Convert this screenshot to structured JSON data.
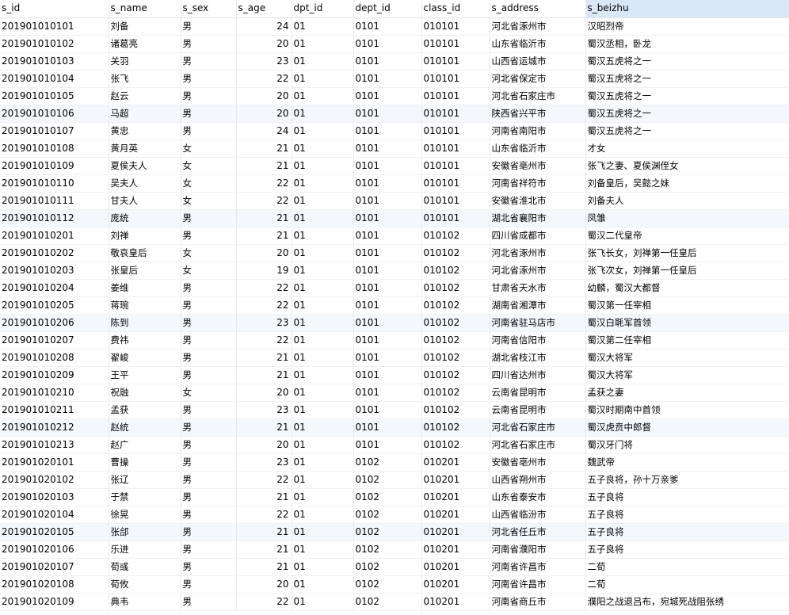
{
  "columns": [
    "s_id",
    "s_name",
    "s_sex",
    "s_age",
    "dpt_id",
    "dept_id",
    "class_id",
    "s_address",
    "s_beizhu"
  ],
  "selected_column": "s_beizhu",
  "rows": [
    [
      "201901010101",
      "刘备",
      "男",
      "24",
      "01",
      "0101",
      "010101",
      "河北省涿州市",
      "汉昭烈帝"
    ],
    [
      "201901010102",
      "诸葛亮",
      "男",
      "20",
      "01",
      "0101",
      "010101",
      "山东省临沂市",
      "蜀汉丞相，卧龙"
    ],
    [
      "201901010103",
      "关羽",
      "男",
      "23",
      "01",
      "0101",
      "010101",
      "山西省运城市",
      "蜀汉五虎将之一"
    ],
    [
      "201901010104",
      "张飞",
      "男",
      "22",
      "01",
      "0101",
      "010101",
      "河北省保定市",
      "蜀汉五虎将之一"
    ],
    [
      "201901010105",
      "赵云",
      "男",
      "20",
      "01",
      "0101",
      "010101",
      "河北省石家庄市",
      "蜀汉五虎将之一"
    ],
    [
      "201901010106",
      "马超",
      "男",
      "20",
      "01",
      "0101",
      "010101",
      "陕西省兴平市",
      "蜀汉五虎将之一"
    ],
    [
      "201901010107",
      "黄忠",
      "男",
      "24",
      "01",
      "0101",
      "010101",
      "河南省南阳市",
      "蜀汉五虎将之一"
    ],
    [
      "201901010108",
      "黄月英",
      "女",
      "21",
      "01",
      "0101",
      "010101",
      "山东省临沂市",
      "才女"
    ],
    [
      "201901010109",
      "夏侯夫人",
      "女",
      "21",
      "01",
      "0101",
      "010101",
      "安徽省亳州市",
      "张飞之妻、夏侯渊侄女"
    ],
    [
      "201901010110",
      "吴夫人",
      "女",
      "22",
      "01",
      "0101",
      "010101",
      "河南省祥符市",
      "刘备皇后，吴懿之妹"
    ],
    [
      "201901010111",
      "甘夫人",
      "女",
      "22",
      "01",
      "0101",
      "010101",
      "安徽省淮北市",
      "刘备夫人"
    ],
    [
      "201901010112",
      "庞统",
      "男",
      "21",
      "01",
      "0101",
      "010101",
      "湖北省襄阳市",
      "凤雏"
    ],
    [
      "201901010201",
      "刘禅",
      "男",
      "21",
      "01",
      "0101",
      "010102",
      "四川省成都市",
      "蜀汉二代皇帝"
    ],
    [
      "201901010202",
      "敬哀皇后",
      "女",
      "20",
      "01",
      "0101",
      "010102",
      "河北省涿州市",
      "张飞长女，刘禅第一任皇后"
    ],
    [
      "201901010203",
      "张皇后",
      "女",
      "19",
      "01",
      "0101",
      "010102",
      "河北省涿州市",
      "张飞次女，刘禅第一任皇后"
    ],
    [
      "201901010204",
      "姜维",
      "男",
      "22",
      "01",
      "0101",
      "010102",
      "甘肃省天水市",
      "幼麟，蜀汉大都督"
    ],
    [
      "201901010205",
      "蒋琬",
      "男",
      "22",
      "01",
      "0101",
      "010102",
      "湖南省湘潭市",
      "蜀汉第一任宰相"
    ],
    [
      "201901010206",
      "陈到",
      "男",
      "23",
      "01",
      "0101",
      "010102",
      "河南省驻马店市",
      "蜀汉白毦军首领"
    ],
    [
      "201901010207",
      "费祎",
      "男",
      "22",
      "01",
      "0101",
      "010102",
      "河南省信阳市",
      "蜀汉第二任宰相"
    ],
    [
      "201901010208",
      "翟峻",
      "男",
      "21",
      "01",
      "0101",
      "010102",
      "湖北省枝江市",
      "蜀汉大将军"
    ],
    [
      "201901010209",
      "王平",
      "男",
      "21",
      "01",
      "0101",
      "010102",
      "四川省达州市",
      "蜀汉大将军"
    ],
    [
      "201901010210",
      "祝融",
      "女",
      "20",
      "01",
      "0101",
      "010102",
      "云南省昆明市",
      "孟获之妻"
    ],
    [
      "201901010211",
      "孟获",
      "男",
      "23",
      "01",
      "0101",
      "010102",
      "云南省昆明市",
      "蜀汉时期南中首领"
    ],
    [
      "201901010212",
      "赵统",
      "男",
      "21",
      "01",
      "0101",
      "010102",
      "河北省石家庄市",
      "蜀汉虎贲中郎督"
    ],
    [
      "201901010213",
      "赵广",
      "男",
      "20",
      "01",
      "0101",
      "010102",
      "河北省石家庄市",
      "蜀汉牙门将"
    ],
    [
      "201901020101",
      "曹操",
      "男",
      "23",
      "01",
      "0102",
      "010201",
      "安徽省亳州市",
      "魏武帝"
    ],
    [
      "201901020102",
      "张辽",
      "男",
      "22",
      "01",
      "0102",
      "010201",
      "山西省朔州市",
      "五子良将，孙十万亲爹"
    ],
    [
      "201901020103",
      "于禁",
      "男",
      "21",
      "01",
      "0102",
      "010201",
      "山东省泰安市",
      "五子良将"
    ],
    [
      "201901020104",
      "徐晃",
      "男",
      "22",
      "01",
      "0102",
      "010201",
      "山西省临汾市",
      "五子良将"
    ],
    [
      "201901020105",
      "张郃",
      "男",
      "21",
      "01",
      "0102",
      "010201",
      "河北省任丘市",
      "五子良将"
    ],
    [
      "201901020106",
      "乐进",
      "男",
      "21",
      "01",
      "0102",
      "010201",
      "河南省濮阳市",
      "五子良将"
    ],
    [
      "201901020107",
      "荀彧",
      "男",
      "21",
      "01",
      "0102",
      "010201",
      "河南省许昌市",
      "二荀"
    ],
    [
      "201901020108",
      "荀攸",
      "男",
      "20",
      "01",
      "0102",
      "010201",
      "河南省许昌市",
      "二荀"
    ],
    [
      "201901020109",
      "典韦",
      "男",
      "22",
      "01",
      "0102",
      "010201",
      "河南省商丘市",
      "濮阳之战退吕布，宛城死战阻张绣"
    ]
  ]
}
